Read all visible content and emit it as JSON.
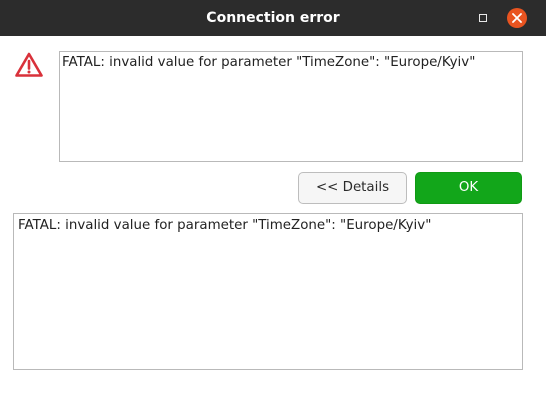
{
  "window": {
    "title": "Connection error"
  },
  "titlebar": {
    "maximize_icon": "maximize-icon",
    "close_icon": "close-icon",
    "close_color": "#e95420"
  },
  "message": {
    "icon": "warning-icon",
    "text": "FATAL: invalid value for parameter \"TimeZone\": \"Europe/Kyiv\""
  },
  "buttons": {
    "details_label": "<< Details",
    "ok_label": "OK",
    "ok_color": "#12a61a"
  },
  "details": {
    "text": "FATAL: invalid value for parameter \"TimeZone\": \"Europe/Kyiv\""
  }
}
